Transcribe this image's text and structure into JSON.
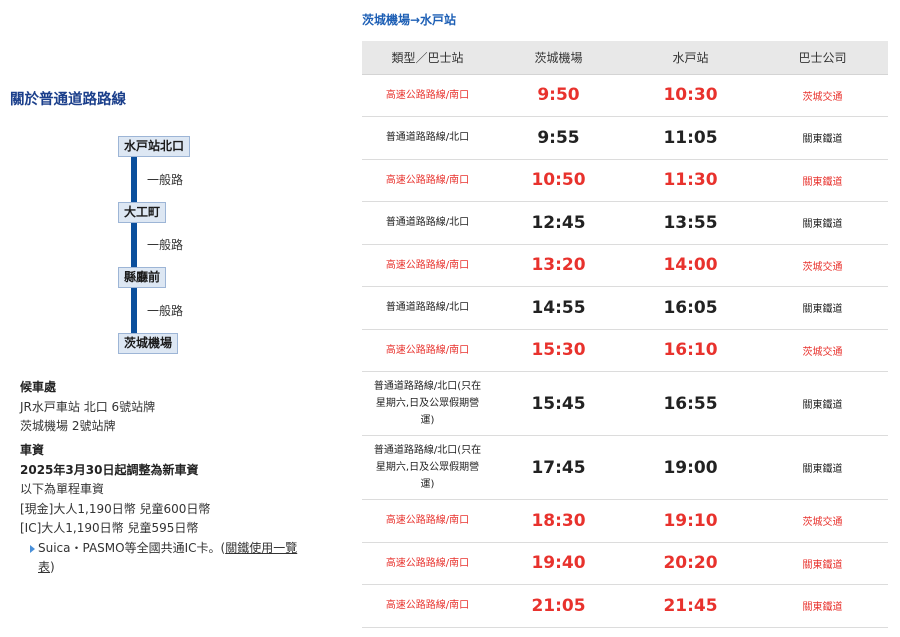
{
  "colors": {
    "express": "#e8322d",
    "regular": "#222222",
    "heading_blue": "#1d5fb5",
    "title_navy": "#1b3f8b",
    "route_line": "#0b4f9c",
    "header_bg": "#e8e8e8"
  },
  "icons": {
    "ic_note_bullet": "triangle-right-icon"
  },
  "left": {
    "title": "關於普通道路路線",
    "route": {
      "stops": [
        "水戸站北口",
        "大工町",
        "縣廳前",
        "茨城機場"
      ],
      "segments": [
        "一般路",
        "一般路",
        "一般路"
      ]
    },
    "boarding": {
      "heading": "候車處",
      "lines": [
        "JR水戸車站 北口 6號站牌",
        "茨城機場 2號站牌"
      ]
    },
    "fare": {
      "heading": "車資",
      "notice": "2025年3月30日起調整為新車資",
      "lines": [
        "以下為單程車資",
        "[現金]大人1,190日幣 兒童600日幣",
        "[IC]大人1,190日幣 兒童595日幣"
      ],
      "ic_note": {
        "text": "Suica・PASMO等全國共通IC卡。(",
        "link": "關鐵使用一覽表",
        "close": ")"
      }
    }
  },
  "timetable": {
    "heading": "茨城機場→水戸站",
    "columns": [
      "類型／巴士站",
      "茨城機場",
      "水戸站",
      "巴士公司"
    ],
    "rows": [
      {
        "type": "高速公路路線/南口",
        "depart": "9:50",
        "arrive": "10:30",
        "company": "茨城交通",
        "highlight": true
      },
      {
        "type": "普通道路路線/北口",
        "depart": "9:55",
        "arrive": "11:05",
        "company": "關東鐵道",
        "highlight": false
      },
      {
        "type": "高速公路路線/南口",
        "depart": "10:50",
        "arrive": "11:30",
        "company": "關東鐵道",
        "highlight": true
      },
      {
        "type": "普通道路路線/北口",
        "depart": "12:45",
        "arrive": "13:55",
        "company": "關東鐵道",
        "highlight": false
      },
      {
        "type": "高速公路路線/南口",
        "depart": "13:20",
        "arrive": "14:00",
        "company": "茨城交通",
        "highlight": true
      },
      {
        "type": "普通道路路線/北口",
        "depart": "14:55",
        "arrive": "16:05",
        "company": "關東鐵道",
        "highlight": false
      },
      {
        "type": "高速公路路線/南口",
        "depart": "15:30",
        "arrive": "16:10",
        "company": "茨城交通",
        "highlight": true
      },
      {
        "type": "普通道路路線/北口(只在星期六,日及公眾假期營運)",
        "depart": "15:45",
        "arrive": "16:55",
        "company": "關東鐵道",
        "highlight": false
      },
      {
        "type": "普通道路路線/北口(只在星期六,日及公眾假期營運)",
        "depart": "17:45",
        "arrive": "19:00",
        "company": "關東鐵道",
        "highlight": false
      },
      {
        "type": "高速公路路線/南口",
        "depart": "18:30",
        "arrive": "19:10",
        "company": "茨城交通",
        "highlight": true
      },
      {
        "type": "高速公路路線/南口",
        "depart": "19:40",
        "arrive": "20:20",
        "company": "關東鐵道",
        "highlight": true
      },
      {
        "type": "高速公路路線/南口",
        "depart": "21:05",
        "arrive": "21:45",
        "company": "關東鐵道",
        "highlight": true
      }
    ]
  }
}
